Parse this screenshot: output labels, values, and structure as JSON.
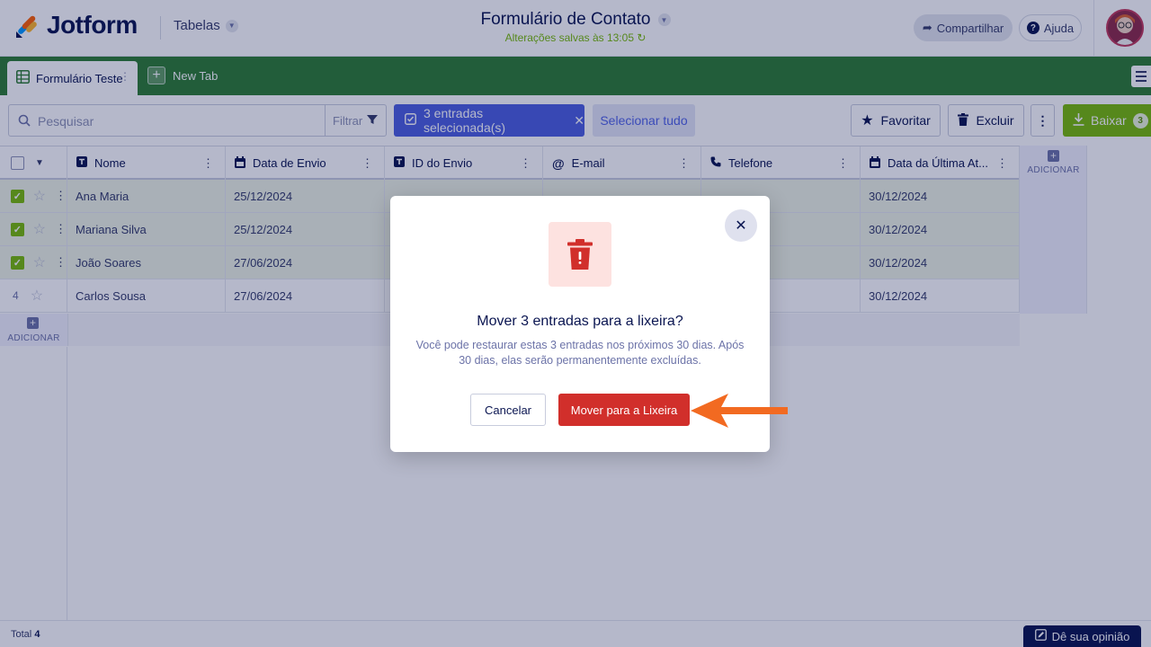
{
  "header": {
    "logo_text": "Jotform",
    "tables_label": "Tabelas",
    "form_title": "Formulário de Contato",
    "saved_status": "Alterações salvas às 13:05",
    "share_label": "Compartilhar",
    "help_label": "Ajuda"
  },
  "tabs": {
    "active_label": "Formulário Teste",
    "new_tab_label": "New Tab"
  },
  "toolbar": {
    "search_placeholder": "Pesquisar",
    "filter_label": "Filtrar",
    "selected_label": "3 entradas selecionada(s)",
    "select_all_label": "Selecionar tudo",
    "favorite_label": "Favoritar",
    "delete_label": "Excluir",
    "download_label": "Baixar",
    "download_count": "3"
  },
  "table": {
    "columns": [
      "Nome",
      "Data de Envio",
      "ID do Envio",
      "E-mail",
      "Telefone",
      "Data da Última At..."
    ],
    "add_column_label": "ADICIONAR",
    "add_row_label": "ADICIONAR",
    "rows": [
      {
        "selected": true,
        "index": "",
        "cells": [
          "Ana Maria",
          "25/12/2024",
          "",
          "",
          "",
          "30/12/2024"
        ]
      },
      {
        "selected": true,
        "index": "",
        "cells": [
          "Mariana Silva",
          "25/12/2024",
          "",
          "",
          "",
          "30/12/2024"
        ]
      },
      {
        "selected": true,
        "index": "",
        "cells": [
          "João Soares",
          "27/06/2024",
          "",
          "",
          "",
          "30/12/2024"
        ]
      },
      {
        "selected": false,
        "index": "4",
        "cells": [
          "Carlos Sousa",
          "27/06/2024",
          "",
          "",
          "",
          "30/12/2024"
        ]
      }
    ]
  },
  "footer": {
    "total_label": "Total",
    "total_value": "4",
    "feedback_label": "Dê sua opinião"
  },
  "modal": {
    "title": "Mover 3 entradas para a lixeira?",
    "description": "Você pode restaurar estas 3 entradas nos próximos 30 dias. Após 30 dias, elas serão permanentemente excluídas.",
    "cancel_label": "Cancelar",
    "confirm_label": "Mover para a Lixeira"
  },
  "colors": {
    "brand_green": "#2d7d31",
    "accent_blue": "#4c5fe0",
    "danger_red": "#d12f2b",
    "callout_arrow": "#f26a21"
  }
}
